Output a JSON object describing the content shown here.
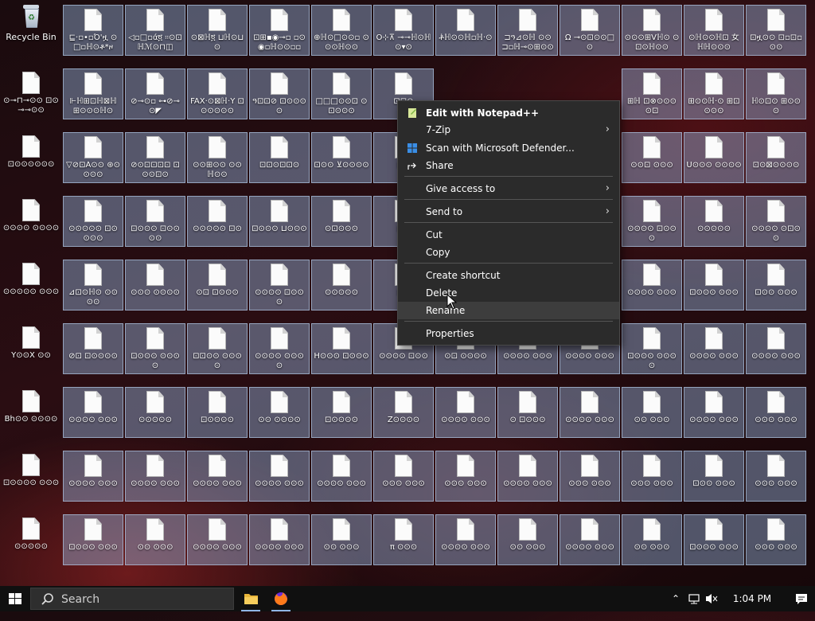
{
  "desktop": {
    "recycle_bin": "Recycle Bin",
    "row_labels": [
      [
        "⊑·▫•▫Ό'ዟ ⊙□▫ℍ⊙ቶ*ዞ",
        "◁▫□▫ά፬ ፡፡⊙⊡ℍℳ⊙⊓◫",
        "⊙⊠ℍ፬ ⊔ℍ⊙⊔⊙",
        "⊡⊞▪◉⊸▫ ▫⊙◉▫ℍ⊙⊙▫▫",
        "⊕ℍ⊙□⊙⊙▫ ⊙⊙⊙ℍ⊙⊙",
        "Ô⊹⊼ ⊸⊸ℍ⊙ℍ⊙▾⊙",
        "ቶ፞ℍ⊙⊙ℍ▫ℍ·⊙",
        "⊐ዓ⊿⊙ℍ ⊙⊙ ⊐▫ℍ⊸⊙⊞⊙⊙",
        "Ω ⊸⊙⊡⊙⊙□⊙",
        "⊙⊙⊙⊞Vℍ⊙ ⊙⊡⊙ℍ⊙⊙",
        "⊙ℍ⊙⊙ℍ⊡ 女ℍℍ⊙⊙⊙",
        "⊡ዟ⊙⊙ ⊡▫⊡▫⊙⊙"
      ],
      [
        "⊩ℍ⊞⊡ℍ⊠ℍ ⊞⊙⊙⊙ℍ⊙",
        "⊘⊸⊙▫ ⊶⊘⊸⊙◤",
        "FAX·⊙⊠ℍ·Y ⊡⊙⊙⊙⊙⊙",
        "ዓ⊡⊡⊘ ⊡⊙⊙⊙⊙",
        "□□□⊙⊙⊡ ⊙⊡⊙⊙⊙",
        "⊡⊡⊙",
        "",
        "",
        "",
        "⊞ℍ ⊡⊗⊙⊙⊙⊙⊡",
        "⊞⊙⊙ℍ·⊙ ⊞⊡⊙⊙⊙",
        "ℍ⊙⊡⊙ ⊞⊙⊙⊙"
      ],
      [
        "▽⊘⊡Á⊙⊙ ⊛⊙⊙⊙⊙",
        "⊘⊙⊡⊡⊡⊡ ⊡⊙⊙⊡⊙",
        "⊙⊙⊞⊙⊙ ⊙⊙ℍ⊙⊙",
        "⊡⊡⊙⊡⊡⊙",
        "⊡⊙⊙ ⊻⊙⊙⊙⊙",
        "⊡⊙",
        "",
        "",
        "",
        "⊙⊙⊡ ⊙⊙⊙",
        "U⊙⊙⊙ ⊙⊙⊙⊙",
        "⊡⊙⊠⊙⊙⊙⊙"
      ],
      [
        "⊙⊙⊙⊙⊙ ⊡⊙⊙⊙⊙",
        "⊡⊙⊙⊙ ⊡⊙⊙⊙⊙",
        "⊙⊙⊙⊙⊙ ⊡⊙",
        "⊡⊙⊙⊙ ⊔⊙⊙⊙",
        "⊙⊡⊙⊙⊙",
        "⊡⊙",
        "",
        "",
        "",
        "⊙⊙⊙⊙ ⊡⊙⊙⊙",
        "⊙⊙⊙⊙⊙",
        "⊙⊙⊙⊙ ⊙⊡⊙⊙"
      ],
      [
        "⊿⊡⊙ℍ⊙ ⊙⊙⊙⊙",
        "⊙⊙⊙ ⊙⊙⊙⊙",
        "⊙⊡ ⊡⊙⊙⊙",
        "⊙⊙⊙⊙ ⊡⊙⊙⊙",
        "⊙⊙⊙⊙⊙",
        "⊡⊙",
        "",
        "",
        "",
        "⊙⊙⊙⊙ ⊙⊙⊙",
        "⊡⊙⊙⊙ ⊙⊙⊙",
        "⊡⊙⊙ ⊙⊙⊙"
      ],
      [
        "⊘⊡ ⊡⊙⊙⊙⊙",
        "⊡⊙⊙⊙ ⊙⊙⊙⊙",
        "⊡⊡⊙⊙ ⊙⊙⊙⊙",
        "⊙⊙⊙⊙ ⊙⊙⊙⊙",
        "H⊙⊙⊙ ⊡⊙⊙⊙",
        "⊙⊙⊙⊙ ⊡⊙⊙",
        "⊙⊡ ⊙⊙⊙⊙",
        "⊙⊙⊙⊙ ⊙⊙⊙",
        "⊙⊙⊙⊙ ⊙⊙⊙",
        "⊡⊙⊙⊙ ⊙⊙⊙⊙",
        "⊙⊙⊙⊙ ⊙⊙⊙",
        "⊙⊙⊙⊙ ⊙⊙⊙"
      ],
      [
        "⊙⊙⊙⊙ ⊙⊙⊙",
        "⊙⊙⊙⊙⊙",
        "⊡⊙⊙⊙⊙",
        "⊙⊙ ⊙⊙⊙⊙",
        "⊡⊙⊙⊙⊙",
        "Z⊙⊙⊙⊙",
        "⊙⊙⊙⊙ ⊙⊙⊙",
        "⊙ ⊡⊙⊙⊙",
        "⊙⊙⊙⊙ ⊙⊙⊙",
        "⊙⊙ ⊙⊙⊙",
        "⊙⊙⊙⊙ ⊙⊙⊙",
        "⊙⊙⊙ ⊙⊙⊙"
      ],
      [
        "⊙⊙⊙⊙ ⊙⊙⊙",
        "⊙⊙⊙⊙ ⊙⊙⊙",
        "⊙⊙⊙⊙ ⊙⊙⊙",
        "⊙⊙⊙⊙ ⊙⊙⊙",
        "⊙⊙⊙⊙ ⊙⊙⊙",
        "⊙⊙⊙ ⊙⊙⊙",
        "⊙⊙⊙ ⊙⊙⊙",
        "⊙⊙⊙⊙ ⊙⊙⊙",
        "⊙⊙⊙ ⊙⊙⊙",
        "⊙⊙⊙ ⊙⊙⊙",
        "⊡⊙⊙ ⊙⊙⊙",
        "⊙⊙⊙ ⊙⊙⊙"
      ],
      [
        "⊡⊙⊙⊙ ⊙⊙⊙",
        "⊙⊙ ⊙⊙⊙",
        "⊙⊙⊙⊙ ⊙⊙⊙",
        "⊙⊙⊙⊙ ⊙⊙⊙",
        "⊙⊙ ⊙⊙⊙",
        "π ⊙⊙⊙",
        "⊙⊙⊙⊙ ⊙⊙⊙",
        "⊙⊙ ⊙⊙⊙",
        "⊙⊙⊙⊙ ⊙⊙⊙",
        "⊙⊙ ⊙⊙⊙",
        "⊡⊙⊙⊙ ⊙⊙⊙",
        "⊙⊙⊙ ⊙⊙⊙"
      ]
    ],
    "left_labels": [
      "",
      "⊙⊸⊓⊸⊙⊙ ⊡⊙⊸⊸⊙⊙",
      "⊡⊙⊙⊙⊙⊙⊙",
      "⊙⊙⊙⊙ ⊙⊙⊙⊙",
      "⊙⊙⊙⊙⊙ ⊙⊙⊙",
      "Y⊙⊙X ⊙⊙",
      "Bh⊙⊙ ⊙⊙⊙⊙",
      "⊡⊙⊙⊙⊙ ⊙⊙⊙",
      "⊙⊙⊙⊙⊙"
    ]
  },
  "context_menu": {
    "items": [
      {
        "label": "Edit with Notepad++",
        "icon": "notepadpp-icon",
        "bold": true
      },
      {
        "label": "7-Zip",
        "submenu": true
      },
      {
        "label": "Scan with Microsoft Defender...",
        "icon": "defender-icon"
      },
      {
        "label": "Share",
        "icon": "share-icon"
      },
      {
        "label": "Give access to",
        "submenu": true
      },
      {
        "label": "Send to",
        "submenu": true
      },
      {
        "label": "Cut"
      },
      {
        "label": "Copy"
      },
      {
        "label": "Create shortcut"
      },
      {
        "label": "Delete"
      },
      {
        "label": "Rename"
      },
      {
        "label": "Properties"
      }
    ]
  },
  "taskbar": {
    "search_placeholder": "Search",
    "clock": "1:04 PM",
    "accent": "#8fb6e6"
  }
}
